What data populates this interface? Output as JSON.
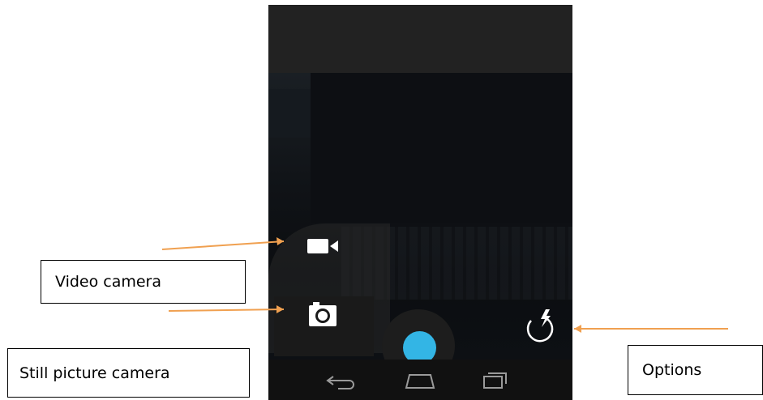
{
  "annotations": {
    "video_label": "Video camera",
    "still_label": "Still picture camera",
    "options_label": "Options"
  },
  "icons": {
    "video": "video-camera-icon",
    "still": "camera-icon",
    "options": "flash-rotate-icon",
    "back": "back-icon",
    "home": "home-icon",
    "recent": "recent-apps-icon"
  },
  "colors": {
    "shutter": "#33b5e5",
    "arrow": "#f0a050"
  }
}
